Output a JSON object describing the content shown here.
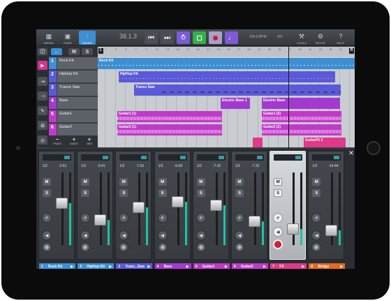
{
  "colors": {
    "cyan": "#3c8fd3",
    "blue": "#5a5ad8",
    "purple": "#a23ad0",
    "magenta": "#c03ac8",
    "pink": "#e0388a",
    "orange": "#e36a1f",
    "meter": "#1bc4a4",
    "record": "#d21e2e",
    "metronome": "#7d5bd6",
    "cycle": "#7a5cd6",
    "play": "#35b04a"
  },
  "toolbar": {
    "media": "MEDIA",
    "pads": "PADS",
    "mixer": "MIXER",
    "counter": "38.1.3",
    "tempo": "154.0 BPM",
    "signature": "4/4",
    "tools": "TOOLS",
    "setup": "SETUP",
    "help": "HELP"
  },
  "track_header": {
    "monitor": "M",
    "solo": "S"
  },
  "ruler": {
    "ticks": [
      "1",
      "3",
      "5",
      "7",
      "9",
      "11",
      "13",
      "15",
      "17",
      "19",
      "21",
      "23",
      "25",
      "27",
      "29",
      "31",
      "33",
      "35",
      "37",
      "39",
      "41",
      "43",
      "45",
      "47",
      "49"
    ],
    "left_marker": "L",
    "right_marker": "R"
  },
  "tracks": [
    {
      "num": "1",
      "name": "Rock Kit"
    },
    {
      "num": "2",
      "name": "HipHop Kit"
    },
    {
      "num": "3",
      "name": "Trance Saw"
    },
    {
      "num": "4",
      "name": "Bass"
    },
    {
      "num": "5",
      "name": "Guitar1"
    },
    {
      "num": "6",
      "name": "Guitar2"
    }
  ],
  "track_footer": {
    "track": "TRACK",
    "audio": "AUDIO",
    "midi": "MIDI"
  },
  "clips": {
    "rock_kit": "Rock Kit",
    "hiphop_kit": "HipHop Kit",
    "trance_saw": "Trance Saw",
    "bass_a": "Electric Bass 1",
    "bass_b": "Electric Bass",
    "guitar1_a": "Guitar1 (1)",
    "guitar1_b": "Guitar1 (2)",
    "guitar2_a": "Guitar2 (1)",
    "guitar2_b": "Guitar2 (2)",
    "guitarfx": "GuitarFX 2"
  },
  "channels": [
    {
      "num": "1",
      "name": "Rock Kit",
      "io": "1/2",
      "vol": "-3.51",
      "level": 0.58
    },
    {
      "num": "2",
      "name": "HipHop Kit",
      "io": "1/2",
      "vol": "-9.41",
      "level": 0.35
    },
    {
      "num": "3",
      "name": "Tranc...Saw",
      "io": "1/2",
      "vol": "-7.53",
      "level": 0.52
    },
    {
      "num": "4",
      "name": "Bass",
      "io": "1/2",
      "vol": "-5.69",
      "level": 0.6
    },
    {
      "num": "5",
      "name": "Guitar1",
      "io": "1/2",
      "vol": "-7.32",
      "level": 0.55
    },
    {
      "num": "6",
      "name": "Guitar2",
      "io": "1/2",
      "vol": "-7.32",
      "level": 0.33
    },
    {
      "num": "7",
      "name": "FX",
      "io": "1/2",
      "vol": "-9.77",
      "level": 0.22
    },
    {
      "num": "8",
      "name": "Bridge",
      "io": "1/2",
      "vol": "-14.44",
      "level": 0.2
    }
  ],
  "mixer_buttons": {
    "mute": "M",
    "solo": "S",
    "edit": "e"
  }
}
